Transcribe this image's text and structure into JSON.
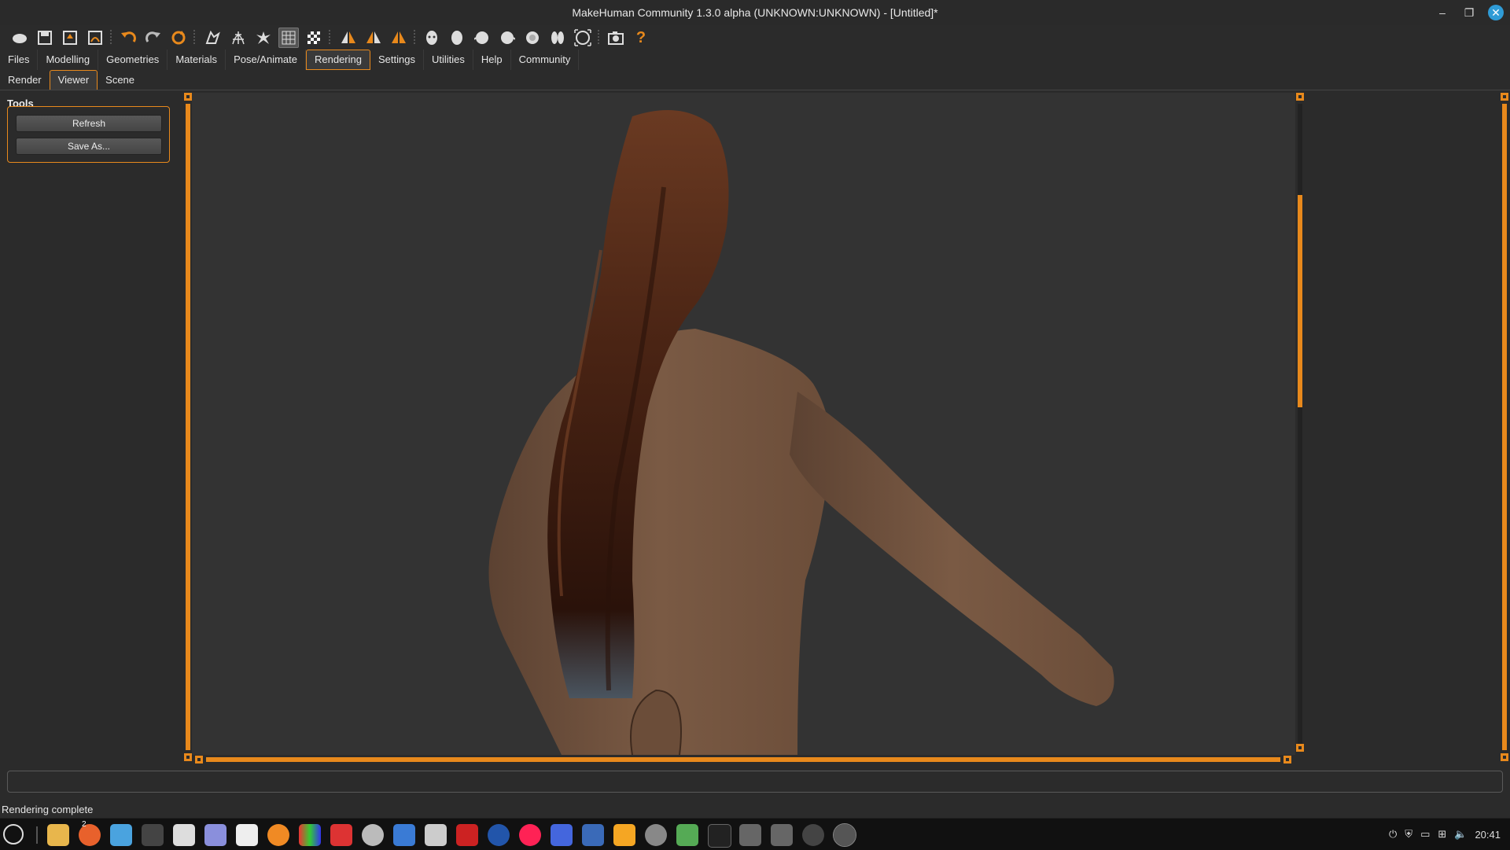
{
  "window": {
    "title": "MakeHuman Community 1.3.0 alpha (UNKNOWN:UNKNOWN) - [Untitled]*"
  },
  "main_tabs": [
    "Files",
    "Modelling",
    "Geometries",
    "Materials",
    "Pose/Animate",
    "Rendering",
    "Settings",
    "Utilities",
    "Help",
    "Community"
  ],
  "active_main_tab": "Rendering",
  "sub_tabs": [
    "Render",
    "Viewer",
    "Scene"
  ],
  "active_sub_tab": "Viewer",
  "tools": {
    "label": "Tools",
    "refresh": "Refresh",
    "save_as": "Save As..."
  },
  "status": {
    "message": "Rendering complete"
  },
  "taskbar": {
    "clock": "20:41",
    "badge": "2"
  },
  "colors": {
    "accent": "#e8891c",
    "viewport_bg": "#333333",
    "window_bg": "#2b2b2b",
    "close": "#2f9bd6"
  }
}
